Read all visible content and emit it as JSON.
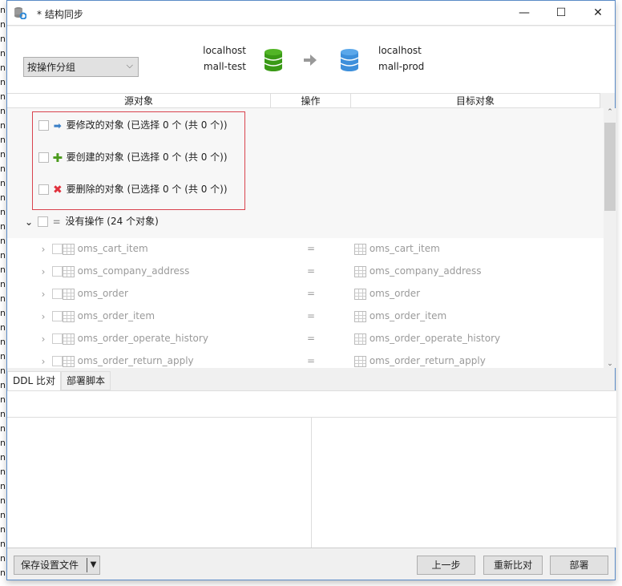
{
  "background_glyph": "n",
  "window": {
    "title": "* 结构同步",
    "minimize": "—",
    "maximize": "☐",
    "close": "✕"
  },
  "header": {
    "group_select": "按操作分组",
    "source": {
      "host": "localhost",
      "db": "mall-test"
    },
    "target": {
      "host": "localhost",
      "db": "mall-prod"
    },
    "source_color": "#3a9a16",
    "target_color": "#3d8fdb"
  },
  "columns": {
    "source": "源对象",
    "action": "操作",
    "target": "目标对象"
  },
  "groups": [
    {
      "icon": "arrow-right",
      "label": "要修改的对象 (已选择 0 个 (共 0 个))"
    },
    {
      "icon": "plus",
      "label": "要创建的对象 (已选择 0 个 (共 0 个))"
    },
    {
      "icon": "cross",
      "label": "要删除的对象 (已选择 0 个 (共 0 个))"
    }
  ],
  "no_action_group": {
    "label": "没有操作 (24 个对象)",
    "symbol": "="
  },
  "rows": [
    {
      "source": "oms_cart_item",
      "action": "=",
      "target": "oms_cart_item"
    },
    {
      "source": "oms_company_address",
      "action": "=",
      "target": "oms_company_address"
    },
    {
      "source": "oms_order",
      "action": "=",
      "target": "oms_order"
    },
    {
      "source": "oms_order_item",
      "action": "=",
      "target": "oms_order_item"
    },
    {
      "source": "oms_order_operate_history",
      "action": "=",
      "target": "oms_order_operate_history"
    },
    {
      "source": "oms_order_return_apply",
      "action": "=",
      "target": "oms_order_return_apply"
    }
  ],
  "tabs": [
    "DDL 比对",
    "部署脚本"
  ],
  "footer": {
    "save_profile": "保存设置文件",
    "back": "上一步",
    "recompare": "重新比对",
    "deploy": "部署"
  }
}
